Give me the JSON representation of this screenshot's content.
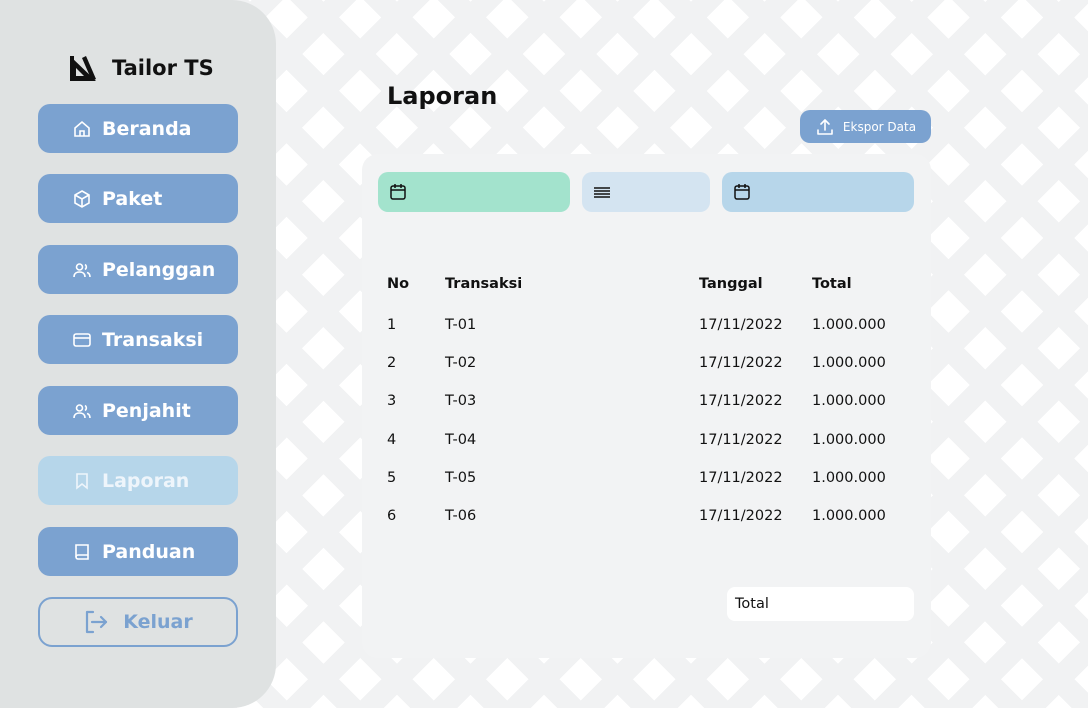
{
  "brand": {
    "name": "Tailor TS",
    "icon": "ruler-triangle-icon"
  },
  "sidebar": {
    "items": [
      {
        "label": "Beranda",
        "icon": "home-icon"
      },
      {
        "label": "Paket",
        "icon": "package-icon"
      },
      {
        "label": "Pelanggan",
        "icon": "users-icon"
      },
      {
        "label": "Transaksi",
        "icon": "credit-card-icon"
      },
      {
        "label": "Penjahit",
        "icon": "users-icon"
      },
      {
        "label": "Laporan",
        "icon": "bookmark-icon",
        "active": true
      },
      {
        "label": "Panduan",
        "icon": "book-icon"
      }
    ],
    "logout_label": "Keluar"
  },
  "main": {
    "title": "Laporan",
    "export_label": "Ekspor Data",
    "filters": [
      {
        "icon": "calendar-icon",
        "color": "#a3e3cd"
      },
      {
        "icon": "menu-lines-icon",
        "color": "#d4e4f1"
      },
      {
        "icon": "calendar-icon",
        "color": "#b7d6ea"
      }
    ],
    "table": {
      "headers": {
        "no": "No",
        "trx": "Transaksi",
        "date": "Tanggal",
        "total": "Total"
      },
      "rows": [
        {
          "no": "1",
          "trx": "T-01",
          "date": "17/11/2022",
          "total": "1.000.000"
        },
        {
          "no": "2",
          "trx": "T-02",
          "date": "17/11/2022",
          "total": "1.000.000"
        },
        {
          "no": "3",
          "trx": "T-03",
          "date": "17/11/2022",
          "total": "1.000.000"
        },
        {
          "no": "4",
          "trx": "T-04",
          "date": "17/11/2022",
          "total": "1.000.000"
        },
        {
          "no": "5",
          "trx": "T-05",
          "date": "17/11/2022",
          "total": "1.000.000"
        },
        {
          "no": "6",
          "trx": "T-06",
          "date": "17/11/2022",
          "total": "1.000.000"
        }
      ]
    },
    "total_label": "Total"
  },
  "colors": {
    "accent": "#7ba2d0",
    "active": "#b6d6ea",
    "sidebar_bg": "#dfe2e2",
    "panel_bg": "#f2f3f4"
  }
}
